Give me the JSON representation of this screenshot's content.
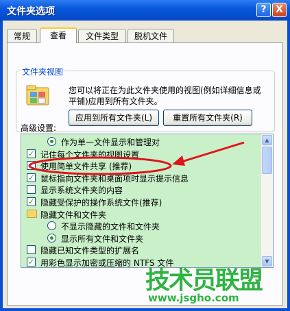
{
  "window": {
    "title": "文件夹选项",
    "help_label": "?",
    "close_label": "X"
  },
  "tabs": [
    {
      "label": "常规"
    },
    {
      "label": "查看",
      "active": true
    },
    {
      "label": "文件类型"
    },
    {
      "label": "脱机文件"
    }
  ],
  "folder_view": {
    "legend": "文件夹视图",
    "description": "您可以将正在为此文件夹使用的视图(例如详细信息或平铺)应用到所有文件夹。",
    "apply_label": "应用到所有文件夹(L)",
    "reset_label": "重置所有文件夹(R)"
  },
  "advanced": {
    "label": "高级设置:",
    "items": [
      {
        "type": "radio",
        "checked": true,
        "indent": 1,
        "label": "作为单一文件显示和管理对"
      },
      {
        "type": "checkbox",
        "checked": true,
        "indent": 0,
        "label": "记住每个文件夹的视图设置"
      },
      {
        "type": "checkbox",
        "checked": false,
        "indent": 0,
        "label": "使用简单文件共享 (推荐)"
      },
      {
        "type": "checkbox",
        "checked": true,
        "indent": 0,
        "label": "鼠标指向文件夹和桌面项时显示提示信息"
      },
      {
        "type": "checkbox",
        "checked": false,
        "indent": 0,
        "label": "显示系统文件夹的内容"
      },
      {
        "type": "checkbox",
        "checked": true,
        "indent": 0,
        "label": "隐藏受保护的操作系统文件(推荐)"
      },
      {
        "type": "folder",
        "checked": false,
        "indent": 0,
        "label": "隐藏文件和文件夹"
      },
      {
        "type": "radio",
        "checked": false,
        "indent": 1,
        "label": "不显示隐藏的文件和文件夹"
      },
      {
        "type": "radio",
        "checked": true,
        "indent": 1,
        "label": "显示所有文件和文件夹"
      },
      {
        "type": "checkbox",
        "checked": false,
        "indent": 0,
        "label": "隐藏已知文件类型的扩展名"
      },
      {
        "type": "checkbox",
        "checked": true,
        "indent": 0,
        "label": "用彩色显示加密或压缩的 NTFS 文件"
      }
    ]
  },
  "scrollbar": {
    "up": "▲",
    "down": "▼"
  },
  "watermark": {
    "text": "技术员联盟",
    "url": "www.jsgho.com"
  },
  "colors": {
    "title_bar": "#0a58dd",
    "list_bg": "#c9f0c9",
    "annotation_red": "#e0141b",
    "watermark_green": "#2fb343"
  }
}
